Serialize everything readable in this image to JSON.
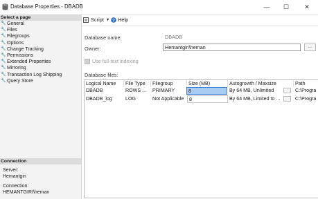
{
  "window": {
    "title": "Database Properties - DBADB",
    "minimize": "—",
    "maximize": "☐",
    "close": "✕"
  },
  "sidebar": {
    "select_page_label": "Select a page",
    "items": [
      {
        "label": "General"
      },
      {
        "label": "Files"
      },
      {
        "label": "Filegroups"
      },
      {
        "label": "Options"
      },
      {
        "label": "Change Tracking"
      },
      {
        "label": "Permissions"
      },
      {
        "label": "Extended Properties"
      },
      {
        "label": "Mirroring"
      },
      {
        "label": "Transaction Log Shipping"
      },
      {
        "label": "Query Store"
      }
    ],
    "connection_label": "Connection",
    "server_label": "Server:",
    "server_value": "Hemantgiri",
    "connection_field_label": "Connection:",
    "connection_value": "HEMANTGIRI\\heman"
  },
  "toolbar": {
    "script_label": "Script",
    "help_label": "Help"
  },
  "form": {
    "db_name_label": "Database name:",
    "db_name_value": "DBADB",
    "owner_label": "Owner:",
    "owner_value": "Hemantgiri\\heman",
    "owner_browse": "...",
    "fulltext_label": "Use full-text indexing",
    "files_label": "Database files:"
  },
  "files_table": {
    "columns": [
      "Logical Name",
      "File Type",
      "Filegroup",
      "Size (MB)",
      "Autogrowth / Maxsize",
      "Path"
    ],
    "rows": [
      {
        "logical_name": "DBADB",
        "file_type": "ROWS ...",
        "filegroup": "PRIMARY",
        "size": "8",
        "autogrowth": "By 64 MB, Unlimited",
        "path": "C:\\Progra"
      },
      {
        "logical_name": "DBADB_log",
        "file_type": "LOG",
        "filegroup": "Not Applicable",
        "size": "8",
        "autogrowth": "By 64 MB, Limited to ...",
        "path": "C:\\Progra"
      }
    ]
  }
}
